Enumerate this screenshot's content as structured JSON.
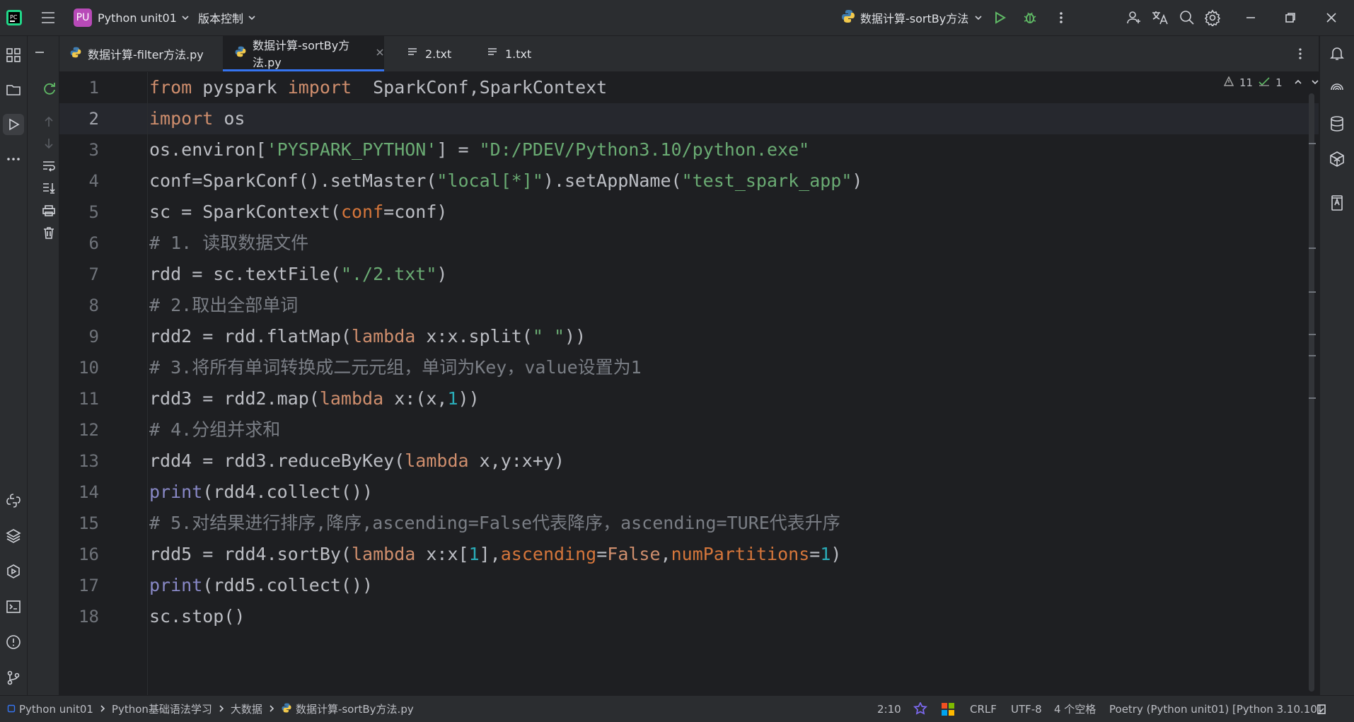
{
  "app": {
    "logo_text": "PC",
    "project_badge": "PU",
    "project_name": "Python unit01",
    "vcs_menu": "版本控制",
    "run_config": "数据计算-sortBy方法"
  },
  "tabs": [
    {
      "label": "数据计算-filter方法.py",
      "type": "python"
    },
    {
      "label": "数据计算-sortBy方法.py",
      "type": "python",
      "active": true
    },
    {
      "label": "2.txt",
      "type": "text"
    },
    {
      "label": "1.txt",
      "type": "text"
    }
  ],
  "inspection": {
    "warnings": "11",
    "ok": "1"
  },
  "code_lines": [
    "from pyspark import  SparkConf,SparkContext",
    "import os",
    "os.environ['PYSPARK_PYTHON'] = \"D:/PDEV/Python3.10/python.exe\"",
    "conf=SparkConf().setMaster(\"local[*]\").setAppName(\"test_spark_app\")",
    "sc = SparkContext(conf=conf)",
    "# 1. 读取数据文件",
    "rdd = sc.textFile(\"./2.txt\")",
    "# 2.取出全部单词",
    "rdd2 = rdd.flatMap(lambda x:x.split(\" \"))",
    "# 3.将所有单词转换成二元元组，单词为Key，value设置为1",
    "rdd3 = rdd2.map(lambda x:(x,1))",
    "# 4.分组并求和",
    "rdd4 = rdd3.reduceByKey(lambda x,y:x+y)",
    "print(rdd4.collect())",
    "# 5.对结果进行排序,降序,ascending=False代表降序，ascending=TURE代表升序",
    "rdd5 = rdd4.sortBy(lambda x:x[1],ascending=False,numPartitions=1)",
    "print(rdd5.collect())",
    "sc.stop()"
  ],
  "line_numbers": [
    "1",
    "2",
    "3",
    "4",
    "5",
    "6",
    "7",
    "8",
    "9",
    "10",
    "11",
    "12",
    "13",
    "14",
    "15",
    "16",
    "17",
    "18"
  ],
  "breadcrumb": [
    "Python unit01",
    "Python基础语法学习",
    "大数据",
    "数据计算-sortBy方法.py"
  ],
  "status": {
    "position": "2:10",
    "line_ending": "CRLF",
    "encoding": "UTF-8",
    "indent": "4 个空格",
    "interpreter": "Poetry (Python unit01) [Python 3.10.10]"
  },
  "colors": {
    "accent": "#3574f0",
    "keyword": "#cf8e6d",
    "string": "#6aab73",
    "comment": "#7a7e85",
    "number": "#2aacb8"
  }
}
